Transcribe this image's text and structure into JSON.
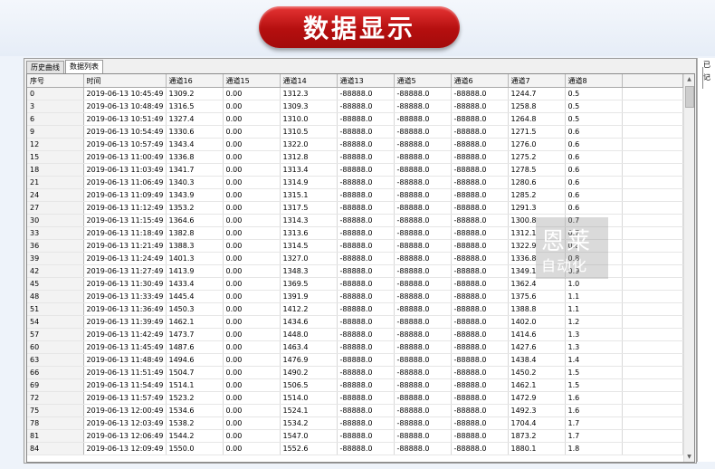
{
  "banner": {
    "title": "数据显示"
  },
  "tabs": [
    {
      "label": "历史曲线"
    },
    {
      "label": "数据列表"
    }
  ],
  "table": {
    "headers": [
      "序号",
      "时间",
      "通道16",
      "通道15",
      "通道14",
      "通道13",
      "通道5",
      "通道6",
      "通道7",
      "通道8"
    ],
    "rows": [
      [
        "0",
        "2019-06-13 10:45:49",
        "1309.2",
        "0.00",
        "1312.3",
        "-88888.0",
        "-88888.0",
        "-88888.0",
        "1244.7",
        "0.5"
      ],
      [
        "3",
        "2019-06-13 10:48:49",
        "1316.5",
        "0.00",
        "1309.3",
        "-88888.0",
        "-88888.0",
        "-88888.0",
        "1258.8",
        "0.5"
      ],
      [
        "6",
        "2019-06-13 10:51:49",
        "1327.4",
        "0.00",
        "1310.0",
        "-88888.0",
        "-88888.0",
        "-88888.0",
        "1264.8",
        "0.5"
      ],
      [
        "9",
        "2019-06-13 10:54:49",
        "1330.6",
        "0.00",
        "1310.5",
        "-88888.0",
        "-88888.0",
        "-88888.0",
        "1271.5",
        "0.6"
      ],
      [
        "12",
        "2019-06-13 10:57:49",
        "1343.4",
        "0.00",
        "1322.0",
        "-88888.0",
        "-88888.0",
        "-88888.0",
        "1276.0",
        "0.6"
      ],
      [
        "15",
        "2019-06-13 11:00:49",
        "1336.8",
        "0.00",
        "1312.8",
        "-88888.0",
        "-88888.0",
        "-88888.0",
        "1275.2",
        "0.6"
      ],
      [
        "18",
        "2019-06-13 11:03:49",
        "1341.7",
        "0.00",
        "1313.4",
        "-88888.0",
        "-88888.0",
        "-88888.0",
        "1278.5",
        "0.6"
      ],
      [
        "21",
        "2019-06-13 11:06:49",
        "1340.3",
        "0.00",
        "1314.9",
        "-88888.0",
        "-88888.0",
        "-88888.0",
        "1280.6",
        "0.6"
      ],
      [
        "24",
        "2019-06-13 11:09:49",
        "1343.9",
        "0.00",
        "1315.1",
        "-88888.0",
        "-88888.0",
        "-88888.0",
        "1285.2",
        "0.6"
      ],
      [
        "27",
        "2019-06-13 11:12:49",
        "1353.2",
        "0.00",
        "1317.5",
        "-88888.0",
        "-88888.0",
        "-88888.0",
        "1291.3",
        "0.6"
      ],
      [
        "30",
        "2019-06-13 11:15:49",
        "1364.6",
        "0.00",
        "1314.3",
        "-88888.0",
        "-88888.0",
        "-88888.0",
        "1300.8",
        "0.7"
      ],
      [
        "33",
        "2019-06-13 11:18:49",
        "1382.8",
        "0.00",
        "1313.6",
        "-88888.0",
        "-88888.0",
        "-88888.0",
        "1312.1",
        "0.7"
      ],
      [
        "36",
        "2019-06-13 11:21:49",
        "1388.3",
        "0.00",
        "1314.5",
        "-88888.0",
        "-88888.0",
        "-88888.0",
        "1322.9",
        "0.8"
      ],
      [
        "39",
        "2019-06-13 11:24:49",
        "1401.3",
        "0.00",
        "1327.0",
        "-88888.0",
        "-88888.0",
        "-88888.0",
        "1336.8",
        "0.8"
      ],
      [
        "42",
        "2019-06-13 11:27:49",
        "1413.9",
        "0.00",
        "1348.3",
        "-88888.0",
        "-88888.0",
        "-88888.0",
        "1349.1",
        "0.9"
      ],
      [
        "45",
        "2019-06-13 11:30:49",
        "1433.4",
        "0.00",
        "1369.5",
        "-88888.0",
        "-88888.0",
        "-88888.0",
        "1362.4",
        "1.0"
      ],
      [
        "48",
        "2019-06-13 11:33:49",
        "1445.4",
        "0.00",
        "1391.9",
        "-88888.0",
        "-88888.0",
        "-88888.0",
        "1375.6",
        "1.1"
      ],
      [
        "51",
        "2019-06-13 11:36:49",
        "1450.3",
        "0.00",
        "1412.2",
        "-88888.0",
        "-88888.0",
        "-88888.0",
        "1388.8",
        "1.1"
      ],
      [
        "54",
        "2019-06-13 11:39:49",
        "1462.1",
        "0.00",
        "1434.6",
        "-88888.0",
        "-88888.0",
        "-88888.0",
        "1402.0",
        "1.2"
      ],
      [
        "57",
        "2019-06-13 11:42:49",
        "1473.7",
        "0.00",
        "1448.0",
        "-88888.0",
        "-88888.0",
        "-88888.0",
        "1414.6",
        "1.3"
      ],
      [
        "60",
        "2019-06-13 11:45:49",
        "1487.6",
        "0.00",
        "1463.4",
        "-88888.0",
        "-88888.0",
        "-88888.0",
        "1427.6",
        "1.3"
      ],
      [
        "63",
        "2019-06-13 11:48:49",
        "1494.6",
        "0.00",
        "1476.9",
        "-88888.0",
        "-88888.0",
        "-88888.0",
        "1438.4",
        "1.4"
      ],
      [
        "66",
        "2019-06-13 11:51:49",
        "1504.7",
        "0.00",
        "1490.2",
        "-88888.0",
        "-88888.0",
        "-88888.0",
        "1450.2",
        "1.5"
      ],
      [
        "69",
        "2019-06-13 11:54:49",
        "1514.1",
        "0.00",
        "1506.5",
        "-88888.0",
        "-88888.0",
        "-88888.0",
        "1462.1",
        "1.5"
      ],
      [
        "72",
        "2019-06-13 11:57:49",
        "1523.2",
        "0.00",
        "1514.0",
        "-88888.0",
        "-88888.0",
        "-88888.0",
        "1472.9",
        "1.6"
      ],
      [
        "75",
        "2019-06-13 12:00:49",
        "1534.6",
        "0.00",
        "1524.1",
        "-88888.0",
        "-88888.0",
        "-88888.0",
        "1492.3",
        "1.6"
      ],
      [
        "78",
        "2019-06-13 12:03:49",
        "1538.2",
        "0.00",
        "1534.2",
        "-88888.0",
        "-88888.0",
        "-88888.0",
        "1704.4",
        "1.7"
      ],
      [
        "81",
        "2019-06-13 12:06:49",
        "1544.2",
        "0.00",
        "1547.0",
        "-88888.0",
        "-88888.0",
        "-88888.0",
        "1873.2",
        "1.7"
      ],
      [
        "84",
        "2019-06-13 12:09:49",
        "1550.0",
        "0.00",
        "1552.6",
        "-88888.0",
        "-88888.0",
        "-88888.0",
        "1880.1",
        "1.8"
      ]
    ]
  },
  "tree": {
    "node1": "已",
    "node2": "记"
  },
  "watermark": {
    "line1": "恩莱",
    "line2": "自动化"
  },
  "icons": {
    "scroll_up": "scroll-up-arrow-icon",
    "scroll_down": "scroll-down-arrow-icon"
  }
}
